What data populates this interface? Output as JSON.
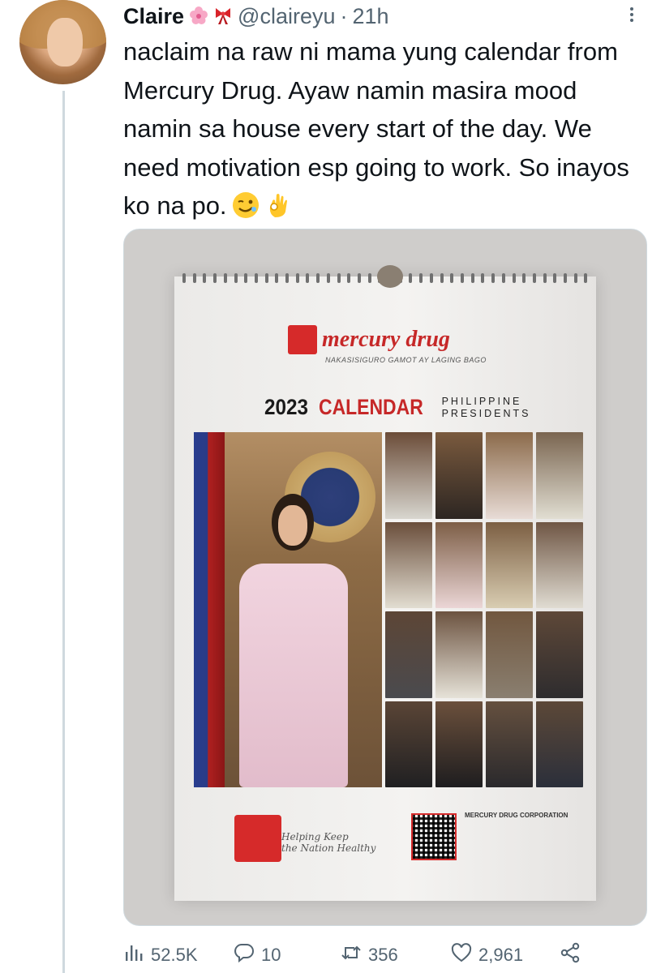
{
  "tweet": {
    "author": {
      "name": "Claire",
      "handle": "@claireyu",
      "time": "21h"
    },
    "name_emojis": [
      "cherry-blossom-icon",
      "ribbon-icon"
    ],
    "text": "naclaim na raw ni mama yung calendar from Mercury Drug. Ayaw namin masira mood namin sa house every start of the day. We need motivation esp going to work. So inayos ko na po.",
    "text_emojis": [
      "winking-face-icon",
      "ok-hand-icon"
    ]
  },
  "calendar_image": {
    "brand": "mercury drug",
    "tagline": "NAKASISIGURO GAMOT AY LAGING BAGO",
    "year": "2023",
    "title_word": "CALENDAR",
    "subtitle_line1": "PHILIPPINE",
    "subtitle_line2": "PRESIDENTS",
    "footer_script_line1": "Helping Keep",
    "footer_script_line2": "the Nation Healthy",
    "corp_name": "MERCURY DRUG CORPORATION"
  },
  "actions": {
    "views": "52.5K",
    "replies": "10",
    "retweets": "356",
    "likes": "2,961"
  },
  "colors": {
    "accent_red": "#c62828",
    "secondary_text": "#536471",
    "thread_line": "#cfd9de"
  }
}
